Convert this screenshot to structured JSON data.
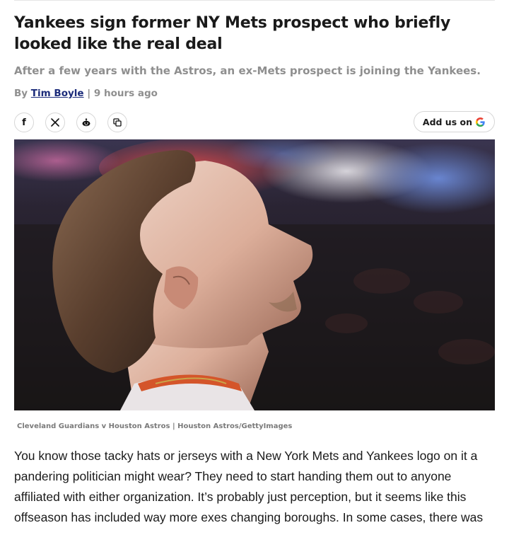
{
  "article": {
    "headline": "Yankees sign former NY Mets prospect who briefly looked like the real deal",
    "dek": "After a few years with the Astros, an ex-Mets prospect is joining the Yankees.",
    "byline": {
      "prefix": "By",
      "author": "Tim Boyle",
      "separator": "|",
      "timestamp": "9 hours ago"
    },
    "share": {
      "facebook_icon": "f",
      "x_icon": "𝕏",
      "add_us_label": "Add us on",
      "add_us_logo": "G"
    },
    "hero_image": {
      "caption": "Cleveland Guardians v Houston Astros | Houston Astros/GettyImages"
    },
    "body": "You know those tacky hats or jerseys with a New York Mets and Yankees logo on it a pandering politician might wear? They need to start handing them out to anyone affiliated with either organization. It’s probably just perception, but it seems like this offseason has included way more exes changing boroughs. In some cases, there was"
  },
  "icons": {
    "facebook": "facebook-icon",
    "x": "x-icon",
    "reddit": "reddit-icon",
    "copy": "copy-link-icon",
    "google": "google-icon"
  },
  "colors": {
    "author_link": "#1b2b7a",
    "muted_text": "#8f8f8f",
    "google_blue": "#4285F4",
    "google_red": "#EA4335",
    "google_yellow": "#FBBC05",
    "google_green": "#34A853"
  }
}
